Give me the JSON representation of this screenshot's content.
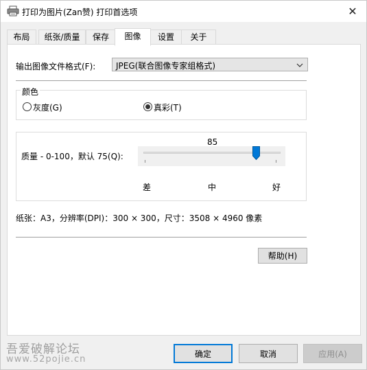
{
  "window": {
    "title": "打印为图片(Zan赞) 打印首选项",
    "close_glyph": "✕"
  },
  "tabs": [
    {
      "label": "布局",
      "active": false
    },
    {
      "label": "纸张/质量",
      "active": false
    },
    {
      "label": "保存",
      "active": false
    },
    {
      "label": "图像",
      "active": true
    },
    {
      "label": "设置",
      "active": false
    },
    {
      "label": "关于",
      "active": false
    }
  ],
  "image": {
    "format_label": "输出图像文件格式(F):",
    "format_value": "JPEG(联合图像专家组格式)",
    "color_group_label": "颜色",
    "grayscale_label": "灰度(G)",
    "truecolor_label": "真彩(T)",
    "color_selected": "truecolor",
    "quality_label": "质量 - 0-100，默认 75(Q):",
    "quality_value": "85",
    "quality_level": 85,
    "quality_low_label": "差",
    "quality_mid_label": "中",
    "quality_high_label": "好",
    "paper_info": "纸张：A3，分辨率(DPI)：300 × 300，尺寸：3508 × 4960 像素"
  },
  "buttons": {
    "help_label": "帮助(H)",
    "ok_label": "确定",
    "cancel_label": "取消",
    "apply_label": "应用(A)"
  },
  "watermark": {
    "line1": "吾爱破解论坛",
    "line2": "www.52pojie.cn"
  },
  "colors": {
    "accent": "#0078d7",
    "window_bg": "#f0f0f0",
    "panel_bg": "#ffffff"
  }
}
